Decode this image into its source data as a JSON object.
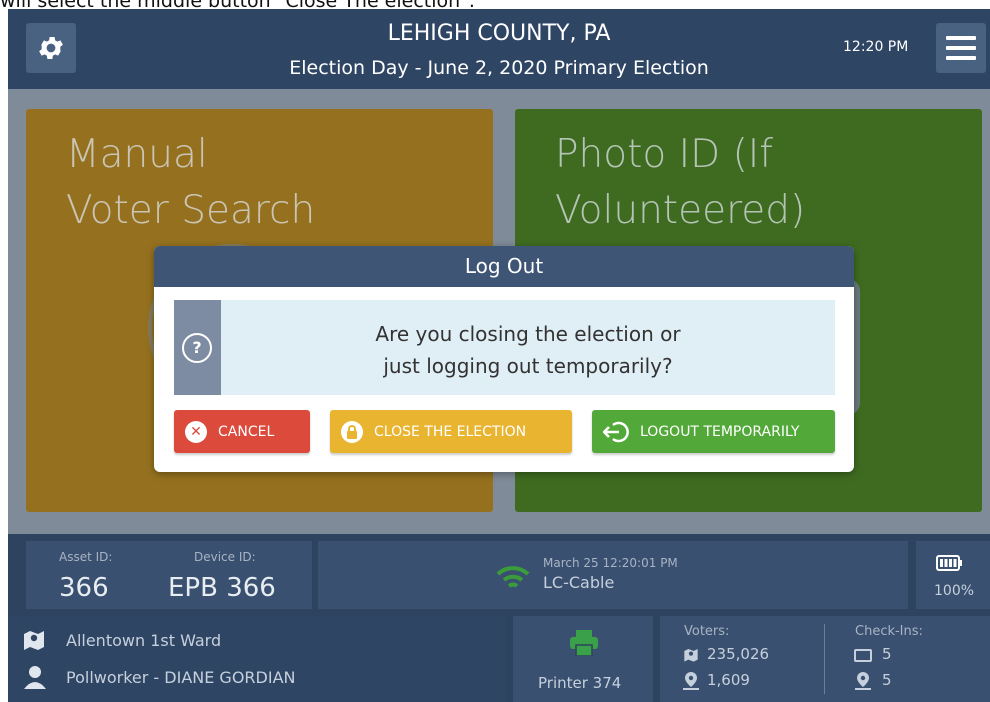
{
  "caption": "will select the middle button \"Close The election\".",
  "header": {
    "county": "LEHIGH COUNTY, PA",
    "subtitle": "Election Day - June 2, 2020 Primary Election",
    "time": "12:20 PM"
  },
  "tiles": [
    {
      "label_line1": "Manual",
      "label_line2": "Voter Search",
      "color": "#95711f"
    },
    {
      "label_line1": "Photo ID (If",
      "label_line2": "Volunteered)",
      "color": "#3f6b20"
    }
  ],
  "dialog": {
    "title": "Log Out",
    "question_line1": "Are you closing the election or",
    "question_line2": "just logging out temporarily?",
    "question_icon": "?",
    "buttons": {
      "cancel": "CANCEL",
      "close": "CLOSE THE ELECTION",
      "logout": "LOGOUT TEMPORARILY"
    },
    "colors": {
      "cancel": "#dc4a3c",
      "close": "#e9b430",
      "logout": "#52a93a"
    }
  },
  "footer": {
    "asset_label": "Asset ID:",
    "asset_value": "366",
    "device_label": "Device ID:",
    "device_value": "EPB 366",
    "network_time": "March 25  12:20:01 PM",
    "network_name": "LC-Cable",
    "battery": "100%",
    "location": "Allentown 1st Ward",
    "pollworker": "Pollworker - DIANE GORDIAN",
    "printer": "Printer 374",
    "voters_label": "Voters:",
    "voters_total": "235,026",
    "voters_local": "1,609",
    "checkins_label": "Check-Ins:",
    "checkins_total": "5",
    "checkins_local": "5"
  }
}
